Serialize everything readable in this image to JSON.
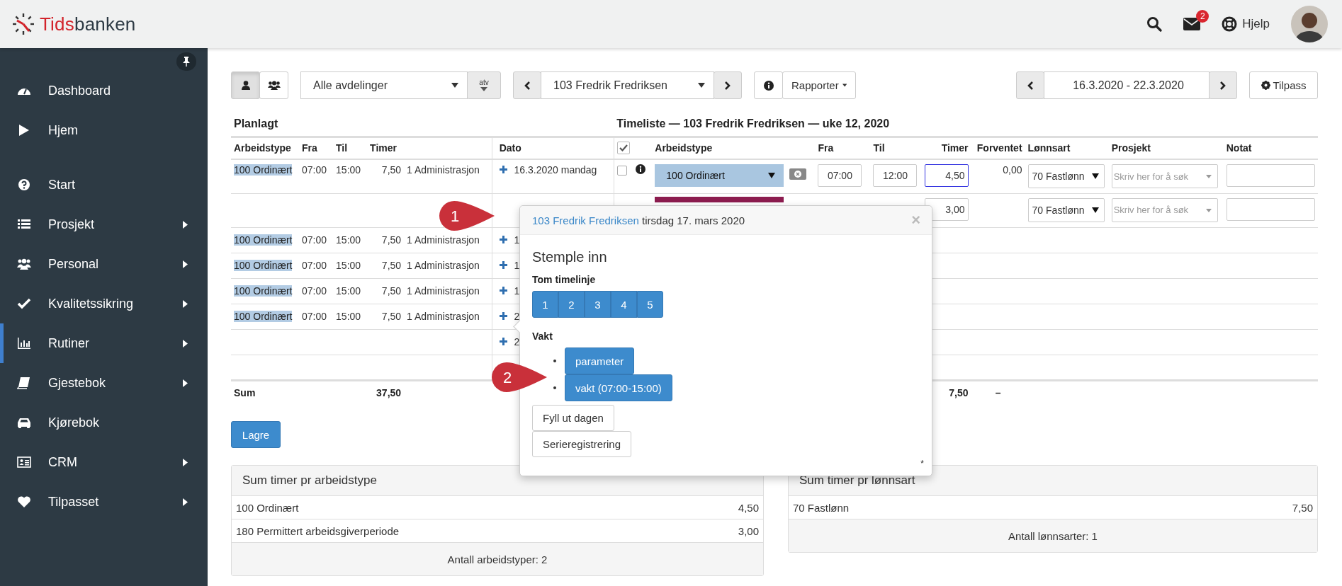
{
  "header": {
    "logo_a": "Tids",
    "logo_b": "banken",
    "mail_badge": "2",
    "help": "Hjelp"
  },
  "sidebar": {
    "sections": [
      [
        {
          "label": "Dashboard",
          "has_submenu": false,
          "selected": false
        },
        {
          "label": "Hjem",
          "has_submenu": false,
          "selected": false
        }
      ],
      [
        {
          "label": "Start",
          "has_submenu": false,
          "selected": false
        },
        {
          "label": "Prosjekt",
          "has_submenu": true,
          "selected": false
        },
        {
          "label": "Personal",
          "has_submenu": true,
          "selected": false
        },
        {
          "label": "Kvalitetssikring",
          "has_submenu": true,
          "selected": false
        },
        {
          "label": "Rutiner",
          "has_submenu": true,
          "selected": true
        },
        {
          "label": "Gjestebok",
          "has_submenu": true,
          "selected": false
        },
        {
          "label": "Kjørebok",
          "has_submenu": false,
          "selected": false
        },
        {
          "label": "CRM",
          "has_submenu": true,
          "selected": false
        },
        {
          "label": "Tilpasset",
          "has_submenu": true,
          "selected": false
        }
      ]
    ]
  },
  "toolbar": {
    "views": [
      {
        "selected": true
      },
      {
        "selected": false
      }
    ],
    "department": "Alle avdelinger",
    "department_button": "atv",
    "employee": "103 Fredrik Fredriksen",
    "reports": "Rapporter",
    "date_range": "16.3.2020 - 22.3.2020",
    "customize": "Tilpass"
  },
  "planned": {
    "title": "Planlagt",
    "columns": [
      "Arbeidstype",
      "Fra",
      "Til",
      "Timer",
      "Dato"
    ],
    "rows": [
      {
        "type": "100 Ordinært",
        "from": "07:00",
        "to": "15:00",
        "hours": "7,50",
        "department": "1 Administrasjon",
        "add": true,
        "date": "16.3.2020 mandag"
      },
      {
        "add": false
      },
      {
        "type": "100 Ordinært",
        "from": "07:00",
        "to": "15:00",
        "hours": "7,50",
        "department": "1 Administrasjon",
        "add": true,
        "date": "1"
      },
      {
        "type": "100 Ordinært",
        "from": "07:00",
        "to": "15:00",
        "hours": "7,50",
        "department": "1 Administrasjon",
        "add": true,
        "date": "1"
      },
      {
        "type": "100 Ordinært",
        "from": "07:00",
        "to": "15:00",
        "hours": "7,50",
        "department": "1 Administrasjon",
        "add": true,
        "date": "1"
      },
      {
        "type": "100 Ordinært",
        "from": "07:00",
        "to": "15:00",
        "hours": "7,50",
        "department": "1 Administrasjon",
        "add": true,
        "date": "2"
      },
      {
        "add": true,
        "date": "2"
      },
      {
        "add": false
      }
    ],
    "sum_label": "Sum",
    "sum_hours": "37,50"
  },
  "timesheet": {
    "title": "Timeliste — 103 Fredrik Fredriksen — uke 12, 2020",
    "all_checked": true,
    "columns": [
      "Arbeidstype",
      "Fra",
      "Til",
      "Timer",
      "Forventet",
      "Lønnsart",
      "Prosjekt",
      "Notat"
    ],
    "rows": [
      {
        "checked": false,
        "type": "100 Ordinært",
        "color": "#a9c6e0",
        "from": "07:00",
        "to": "12:00",
        "hours": "4,50",
        "focused": true,
        "expected": "0,00",
        "wage_type": "70 Fastlønn",
        "project_placeholder": "Skriv her for å søk"
      },
      {
        "color": "#8c1c4f",
        "hours": "3,00",
        "focused": false,
        "wage_type": "70 Fastlønn",
        "project_placeholder": "Skriv her for å søk"
      }
    ],
    "sum_hours": "7,50",
    "sum_expected": "–"
  },
  "save": "Lagre",
  "popup": {
    "employee_link": "103 Fredrik Fredriksen",
    "date": "tirsdag 17. mars 2020",
    "close": "×",
    "heading": "Stemple inn",
    "line_label": "Tom timelinje",
    "line_buttons": [
      "1",
      "2",
      "3",
      "4",
      "5"
    ],
    "shift_label": "Vakt",
    "shift_buttons": [
      "parameter",
      "vakt (07:00-15:00)"
    ],
    "actions": [
      "Fyll ut dagen",
      "Serieregistrering"
    ],
    "footnote": "*"
  },
  "callouts": [
    {
      "label": "1"
    },
    {
      "label": "2"
    }
  ],
  "summaries": [
    {
      "title": "Sum timer pr arbeidstype",
      "rows": [
        {
          "label": "100 Ordinært",
          "value": "4,50"
        },
        {
          "label": "180 Permittert arbeidsgiverperiode",
          "value": "3,00"
        }
      ],
      "footer": "Antall arbeidstyper: 2"
    },
    {
      "title": "Sum timer pr lønnsart",
      "rows": [
        {
          "label": "70 Fastlønn",
          "value": "7,50"
        }
      ],
      "footer": "Antall lønnsarter: 1"
    }
  ]
}
